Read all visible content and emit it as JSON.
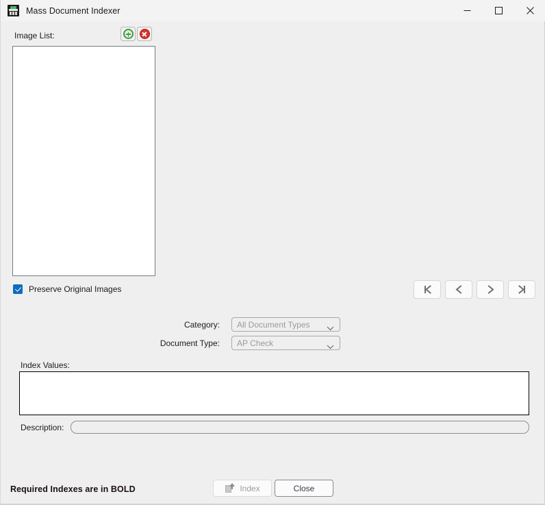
{
  "window": {
    "title": "Mass Document Indexer",
    "app_icon": "scanner-icon",
    "accent_color": "#e08a3c",
    "background_color": "#efefef",
    "controls": {
      "minimize": "minimize-icon",
      "maximize": "maximize-icon",
      "close": "close-icon"
    }
  },
  "image_list": {
    "label": "Image List:",
    "add_button": {
      "icon": "add-circle-icon",
      "color": "#3f9b4b"
    },
    "delete_button": {
      "icon": "delete-circle-icon",
      "color": "#d9342b"
    },
    "items": []
  },
  "preserve": {
    "label": "Preserve Original Images",
    "checked": true,
    "accent": "#0f6cbd"
  },
  "navigation": {
    "first_label": "first-record",
    "previous_label": "previous-record",
    "next_label": "next-record",
    "last_label": "last-record"
  },
  "fields": {
    "category": {
      "label": "Category:",
      "value": "All Document Types",
      "disabled": true,
      "options": [
        "All Document Types"
      ]
    },
    "document_type": {
      "label": "Document Type:",
      "value": "AP Check",
      "disabled": true,
      "options": [
        "AP Check"
      ]
    },
    "index_values": {
      "label": "Index Values:",
      "value": ""
    },
    "description": {
      "label": "Description:",
      "value": "",
      "placeholder": ""
    }
  },
  "footer": {
    "note": "Required Indexes are in BOLD",
    "index_button": {
      "label": "Index",
      "icon": "index-upload-icon",
      "disabled": true
    },
    "close_button": {
      "label": "Close"
    }
  }
}
